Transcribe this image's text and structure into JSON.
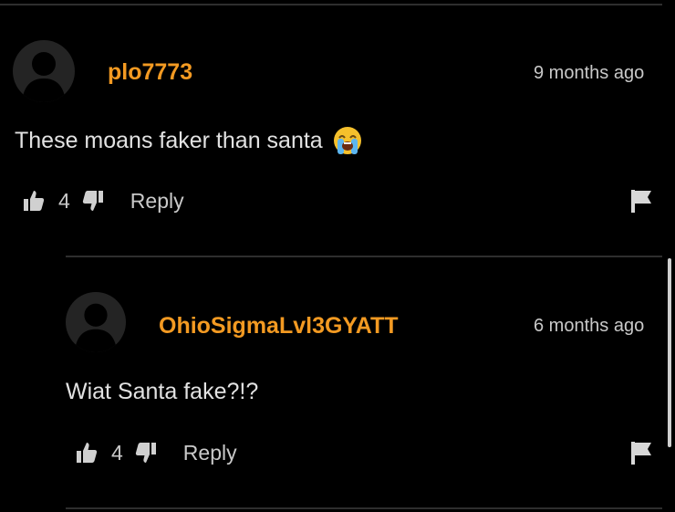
{
  "comments": [
    {
      "username": "plo7773",
      "timestamp": "9 months ago",
      "text": "These moans faker than santa",
      "emoji": "loudly-crying-face-emoji",
      "likes": "4",
      "reply_label": "Reply"
    },
    {
      "username": "OhioSigmaLvl3GYATT",
      "timestamp": "6 months ago",
      "text": "Wiat Santa fake?!?",
      "likes": "4",
      "reply_label": "Reply"
    }
  ],
  "icons": {
    "like": "thumbs-up-icon",
    "dislike": "thumbs-down-icon",
    "report": "flag-icon",
    "avatar": "default-avatar"
  },
  "colors": {
    "background": "#000000",
    "username": "#f39a22",
    "text": "#e2e2e2",
    "muted": "#c9c9c9"
  }
}
